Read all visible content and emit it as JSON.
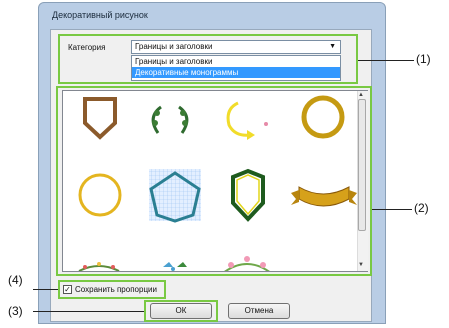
{
  "dialog": {
    "title": "Декоративный рисунок",
    "category_label": "Категория",
    "category_value": "Границы и заголовки",
    "dropdown_options": [
      "Границы и заголовки",
      "Декоративные монограммы"
    ],
    "selected_option_index": 1,
    "keep_proportion_label": "Сохранить пропорции",
    "keep_proportion_checked": true,
    "ok_label": "ОК",
    "cancel_label": "Отмена",
    "gallery_items": [
      "shield-frame",
      "laurel-wreath",
      "circular-arrow",
      "gold-ring",
      "gold-circle-frame",
      "shield-outline-selected",
      "green-shield",
      "gold-ribbon-banner",
      "floral-garland-1",
      "floral-garland-2",
      "floral-garland-3"
    ],
    "selected_item_index": 5
  },
  "annotations": {
    "a1": "(1)",
    "a2": "(2)",
    "a3": "(3)",
    "a4": "(4)"
  },
  "colors": {
    "callout": "#79c943",
    "selection": "#3399ff",
    "dialog_frame": "#b9cde5"
  }
}
